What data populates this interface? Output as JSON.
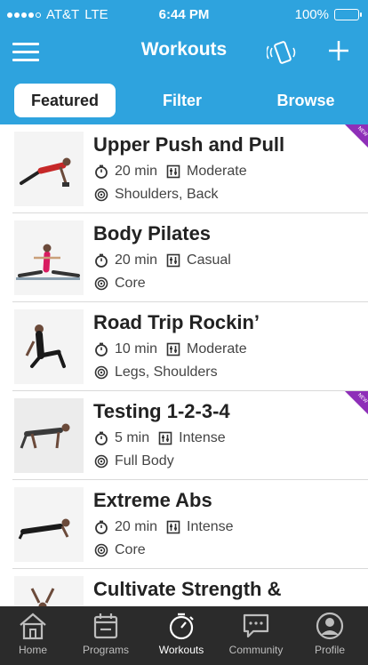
{
  "status_bar": {
    "carrier": "AT&T",
    "network": "LTE",
    "time": "6:44 PM",
    "battery": "100%"
  },
  "nav": {
    "title": "Workouts"
  },
  "segments": {
    "featured": "Featured",
    "filter": "Filter",
    "browse": "Browse"
  },
  "badge_text": "NEW",
  "workouts": [
    {
      "name": "Upper Push and Pull",
      "duration": "20 min",
      "intensity": "Moderate",
      "focus": "Shoulders, Back",
      "is_new": true
    },
    {
      "name": "Body Pilates",
      "duration": "20 min",
      "intensity": "Casual",
      "focus": "Core",
      "is_new": false
    },
    {
      "name": "Road Trip Rockin’",
      "duration": "10 min",
      "intensity": "Moderate",
      "focus": "Legs, Shoulders",
      "is_new": false
    },
    {
      "name": "Testing 1-2-3-4",
      "duration": "5 min",
      "intensity": "Intense",
      "focus": "Full Body",
      "is_new": true
    },
    {
      "name": "Extreme Abs",
      "duration": "20 min",
      "intensity": "Intense",
      "focus": "Core",
      "is_new": false
    },
    {
      "name": "Cultivate Strength &",
      "duration": "",
      "intensity": "",
      "focus": "",
      "is_new": false
    }
  ],
  "tabs": [
    {
      "label": "Home",
      "icon": "home-icon"
    },
    {
      "label": "Programs",
      "icon": "calendar-icon"
    },
    {
      "label": "Workouts",
      "icon": "stopwatch-icon",
      "active": true
    },
    {
      "label": "Community",
      "icon": "chat-icon"
    },
    {
      "label": "Profile",
      "icon": "user-icon"
    }
  ],
  "colors": {
    "header_blue": "#2ea3de",
    "tab_bar": "#2b2b2b",
    "new_badge": "#8e2fb8"
  }
}
